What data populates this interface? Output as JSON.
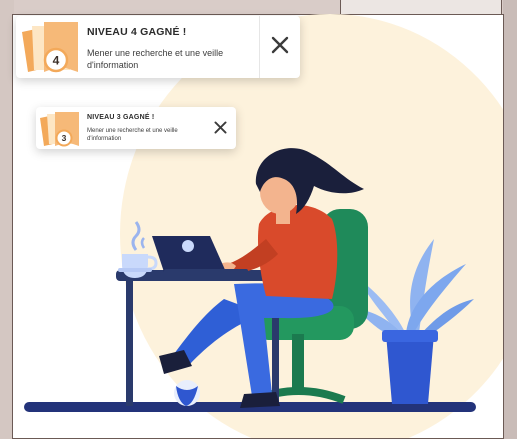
{
  "notifications": [
    {
      "level": "4",
      "title": "NIVEAU 4 GAGNÉ !",
      "description": "Mener une recherche et une veille d'information",
      "close_icon": "close-icon"
    },
    {
      "level": "3",
      "title": "NIVEAU 3 GAGNÉ !",
      "description": "Mener une recherche et une veille d'information",
      "close_icon": "close-icon"
    }
  ],
  "colors": {
    "badge_orange": "#f3a95a",
    "badge_cream": "#fde6c4",
    "sun_cream": "#fdf2dc",
    "desk_navy": "#2a3a8c",
    "shirt_red": "#d94a2b",
    "chair_green": "#1f8a5a",
    "pants_blue": "#2f5fd6",
    "plant_blue": "#7da7ee"
  },
  "illustration": {
    "subject": "woman-at-laptop"
  }
}
